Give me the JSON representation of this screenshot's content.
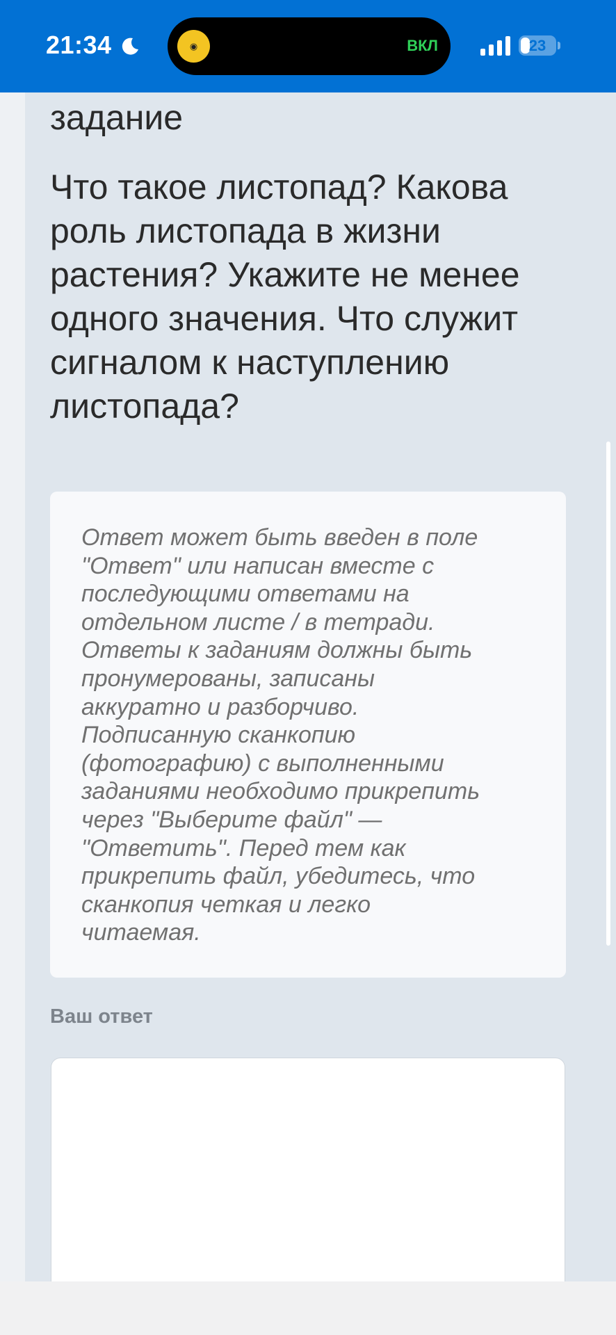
{
  "status_bar": {
    "time": "21:34",
    "island_status": "ВКЛ",
    "battery_level": "23",
    "accent_color": "#0271d4"
  },
  "page": {
    "heading": "задание",
    "question": "Что такое листопад? Какова роль листопада в жизни растения? Укажите не менее одного значения. Что служит сигналом к наступлению листопада?",
    "note": "Ответ может быть введен в поле\n\"Ответ\" или написан вместе с\nпоследующими ответами на\nотдельном листе / в тетради.\nОтветы к заданиям должны быть\nпронумерованы, записаны\nаккуратно и разборчиво.\nПодписанную сканкопию\n(фотографию) с выполненными\nзаданиями необходимо прикрепить\nчерез \"Выберите файл\" —\n\"Ответить\". Перед тем как\nприкрепить файл, убедитесь, что\nсканкопия четкая и легко\nчитаемая.",
    "answer_label": "Ваш ответ"
  }
}
